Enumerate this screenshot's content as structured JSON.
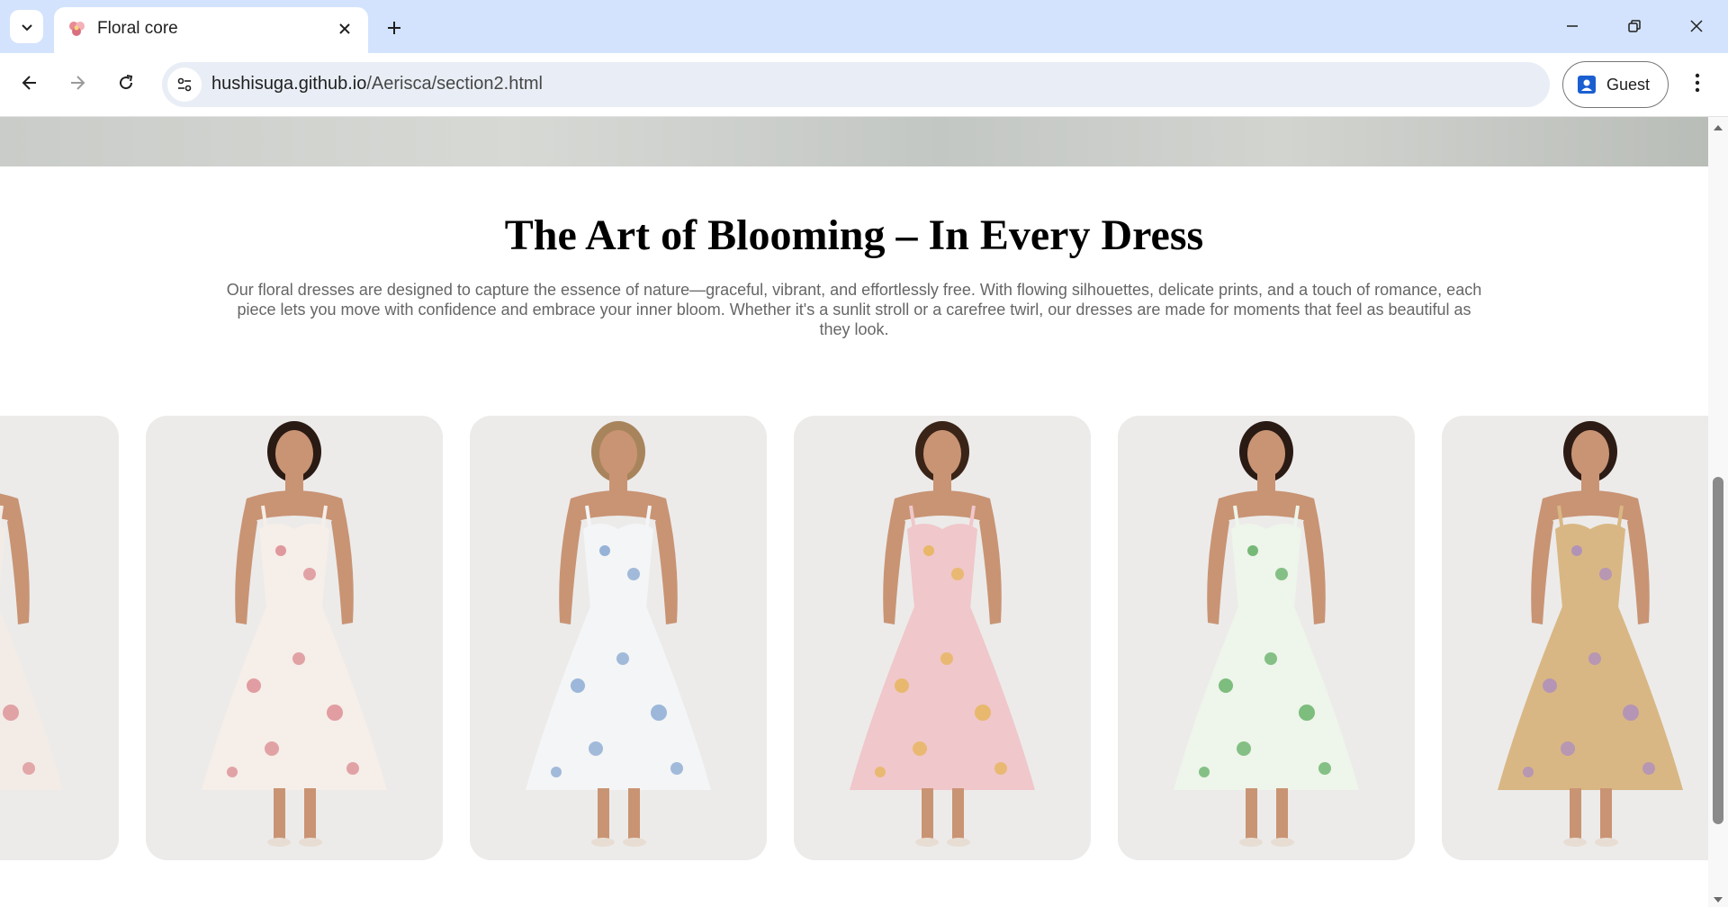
{
  "browser": {
    "tab_title": "Floral core",
    "url_host": "hushisuga.github.io",
    "url_path": "/Aerisca/section2.html",
    "profile_label": "Guest"
  },
  "page": {
    "headline": "The Art of Blooming – In Every Dress",
    "intro": "Our floral dresses are designed to capture the essence of nature—graceful, vibrant, and effortlessly free. With flowing silhouettes, delicate prints, and a touch of romance, each piece lets you move with confidence and embrace your inner bloom. Whether it's a sunlit stroll or a carefree twirl, our dresses are made for moments that feel as beautiful as they look."
  },
  "gallery": [
    {
      "name": "dress-card-partial",
      "dress_color": "#f3ece6",
      "accent": "#d98a8f",
      "hair": "#2b1d17"
    },
    {
      "name": "dress-card-pink-floral",
      "dress_color": "#f6eee8",
      "accent": "#d9828a",
      "hair": "#2a1a14"
    },
    {
      "name": "dress-card-blue-toile",
      "dress_color": "#f4f5f6",
      "accent": "#7fa1cf",
      "hair": "#a8845c"
    },
    {
      "name": "dress-card-pink-pleated",
      "dress_color": "#f0c7ca",
      "accent": "#e6b34f",
      "hair": "#3a2418"
    },
    {
      "name": "dress-card-green-floral",
      "dress_color": "#eef5ea",
      "accent": "#57a95a",
      "hair": "#2a1a14"
    },
    {
      "name": "dress-card-mustard-floral",
      "dress_color": "#d9b784",
      "accent": "#a889c6",
      "hair": "#2d1c15"
    }
  ],
  "colors": {
    "tabstrip": "#d3e3fd",
    "omnibox": "#e9eef6",
    "card_bg": "#ecebea",
    "skin": "#c99474"
  }
}
